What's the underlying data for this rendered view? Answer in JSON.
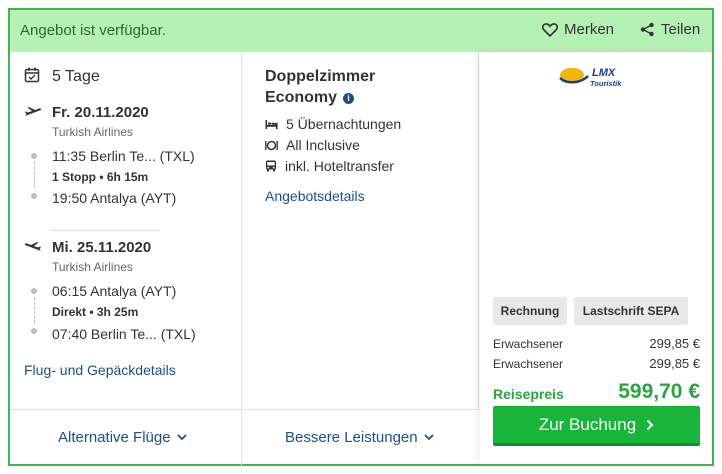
{
  "header": {
    "availability": "Angebot ist verfügbar.",
    "merken_label": "Merken",
    "teilen_label": "Teilen"
  },
  "itinerary": {
    "duration": "5 Tage",
    "outbound": {
      "date": "Fr. 20.11.2020",
      "airline": "Turkish Airlines",
      "depart": "11:35 Berlin Te...  (TXL)",
      "stops": "1 Stopp  •  6h 15m",
      "arrive": "19:50 Antalya (AYT)"
    },
    "return": {
      "date": "Mi. 25.11.2020",
      "airline": "Turkish Airlines",
      "depart": "06:15 Antalya (AYT)",
      "stops": "Direkt  •  3h 25m",
      "arrive": "07:40 Berlin Te...  (TXL)"
    },
    "details_link": "Flug- und Gepäckdetails"
  },
  "hotel": {
    "room_line1": "Doppelzimmer",
    "room_line2": "Economy",
    "features": [
      {
        "icon": "bed-icon",
        "label": "5 Übernachtungen"
      },
      {
        "icon": "food-icon",
        "label": "All Inclusive"
      },
      {
        "icon": "bus-icon",
        "label": "inkl. Hoteltransfer"
      }
    ],
    "details_link": "Angebotsdetails"
  },
  "offer": {
    "logo_text1": "LMX",
    "logo_text2": "Touristik",
    "payment_methods": [
      "Rechnung",
      "Lastschrift SEPA"
    ],
    "prices": [
      {
        "label": "Erwachsener",
        "value": "299,85 €"
      },
      {
        "label": "Erwachsener",
        "value": "299,85 €"
      }
    ],
    "total_label": "Reisepreis",
    "total_value": "599,70 €",
    "book_label": "Zur Buchung"
  },
  "footer": {
    "alt_flights": "Alternative Flüge",
    "better_services": "Bessere Leistungen"
  },
  "colors": {
    "accent_green": "#19b53a",
    "header_green": "#b5f0b5",
    "link_blue": "#1a4f8b"
  }
}
